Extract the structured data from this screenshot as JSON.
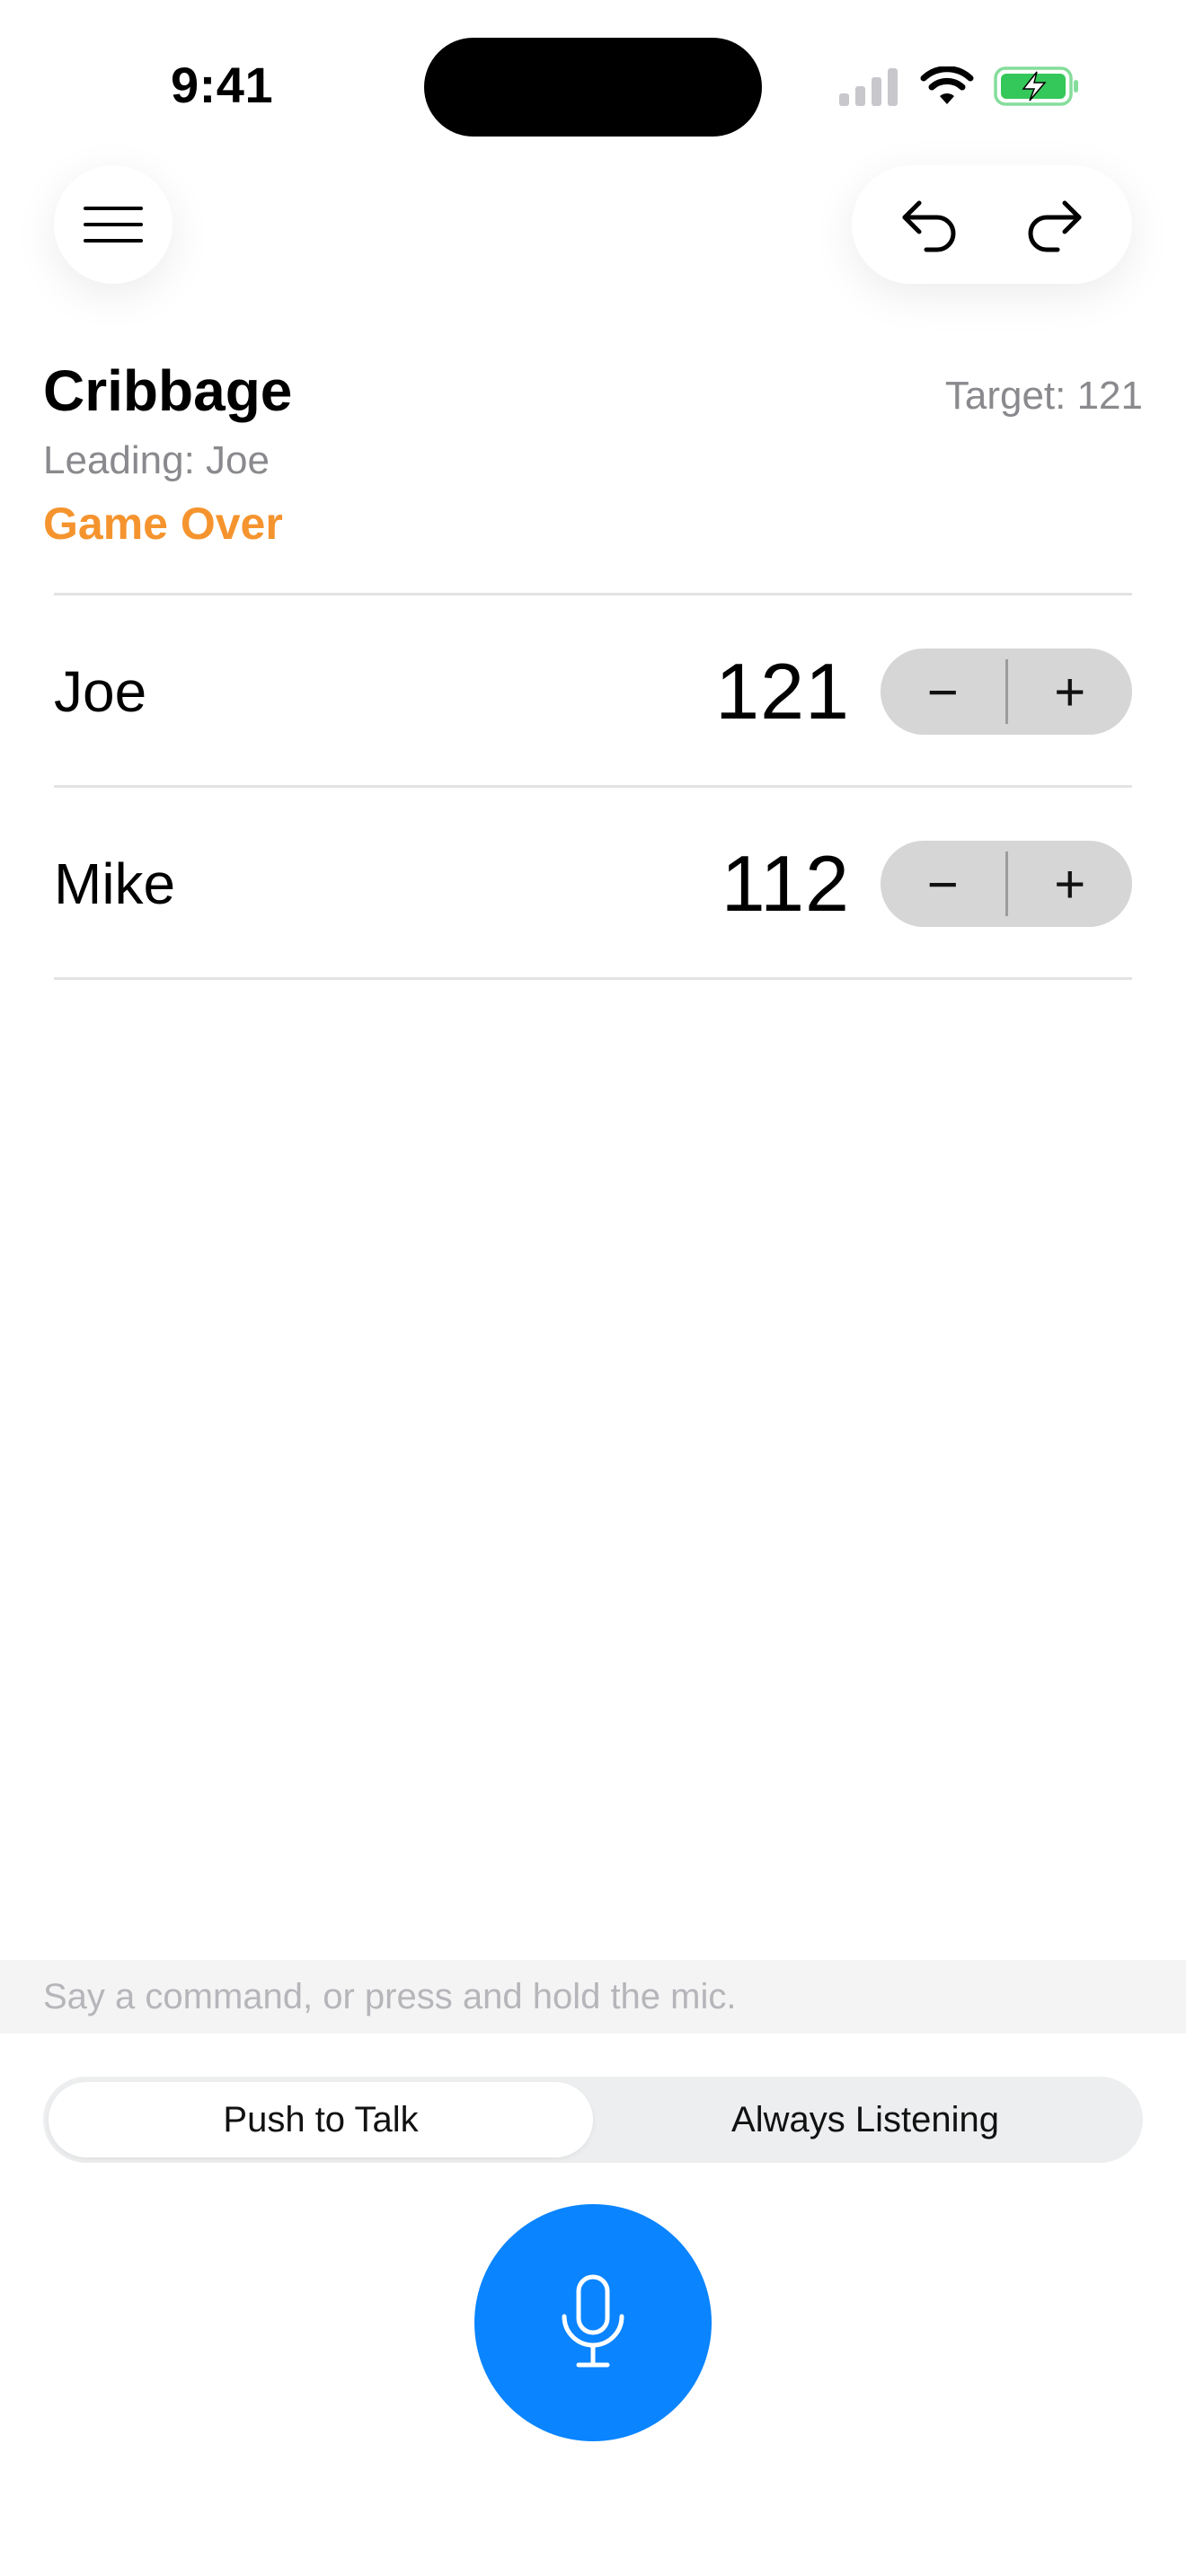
{
  "status_bar": {
    "time": "9:41",
    "icons": [
      "signal-icon",
      "wifi-icon",
      "battery-charging-icon"
    ]
  },
  "toolbar": {
    "menu_icon": "hamburger-menu-icon",
    "undo_icon": "undo-arrow-icon",
    "redo_icon": "redo-arrow-icon"
  },
  "game": {
    "title": "Cribbage",
    "target": "Target: 121",
    "leading": "Leading: Joe",
    "status": "Game Over"
  },
  "players": [
    {
      "name": "Joe",
      "score": "121",
      "minus": "−",
      "plus": "+"
    },
    {
      "name": "Mike",
      "score": "112",
      "minus": "−",
      "plus": "+"
    }
  ],
  "voice": {
    "hint": "Say a command, or press and hold the mic.",
    "modes": [
      "Push to Talk",
      "Always Listening"
    ],
    "selected_mode": "Push to Talk",
    "mic_icon": "microphone-icon"
  },
  "colors": {
    "accent_blue": "#0A84FF",
    "game_over_orange": "#F5942E",
    "secondary_text": "#8A8A8E",
    "battery_green": "#34C759"
  }
}
